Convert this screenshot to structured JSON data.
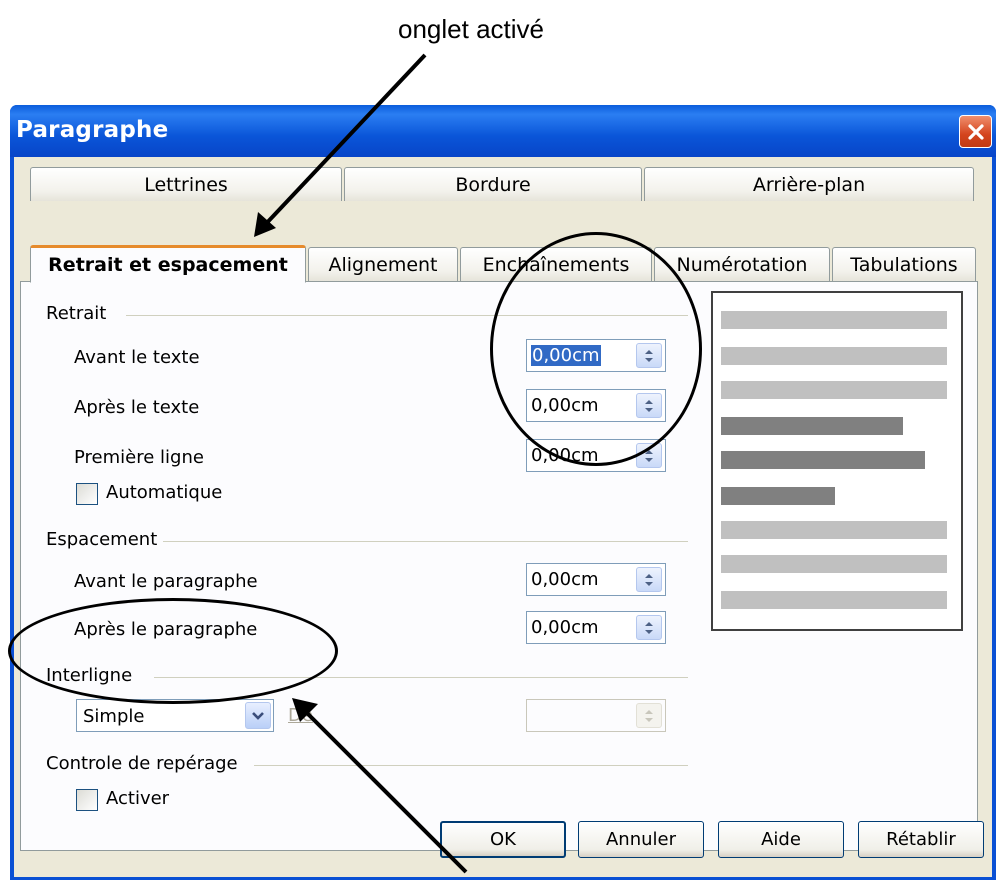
{
  "annotation": {
    "caption": "onglet activé"
  },
  "window": {
    "title": "Paragraphe"
  },
  "tabs": {
    "row1": [
      "Lettrines",
      "Bordure",
      "Arrière-plan"
    ],
    "row2": [
      "Retrait et espacement",
      "Alignement",
      "Enchaînements",
      "Numérotation",
      "Tabulations"
    ],
    "active": "Retrait et espacement"
  },
  "retrait": {
    "heading": "Retrait",
    "avant_label": "Avant le texte",
    "avant_value": "0,00cm",
    "apres_label": "Après le texte",
    "apres_value": "0,00cm",
    "premiere_label": "Première ligne",
    "premiere_value": "0,00cm",
    "auto_label": "Automatique"
  },
  "espacement": {
    "heading": "Espacement",
    "avant_label": "Avant le paragraphe",
    "avant_value": "0,00cm",
    "apres_label": "Après le paragraphe",
    "apres_value": "0,00cm"
  },
  "interligne": {
    "heading": "Interligne",
    "selected": "Simple",
    "de_label": "De",
    "de_value": ""
  },
  "controle": {
    "heading": "Controle de repérage",
    "activer_label": "Activer"
  },
  "buttons": {
    "ok": "OK",
    "annuler": "Annuler",
    "aide": "Aide",
    "retablir": "Rétablir"
  },
  "colors": {
    "titlebar": "#0a55d8",
    "active_tab_accent": "#e68b2c",
    "preview_light_bar": "#c0c0c0",
    "preview_dark_bar": "#808080"
  }
}
